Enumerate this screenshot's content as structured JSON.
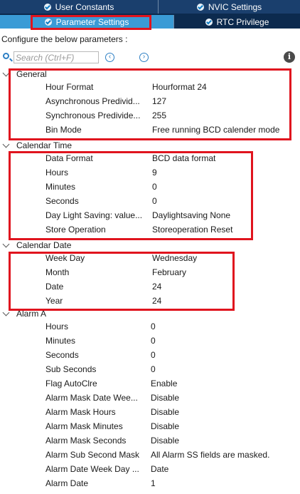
{
  "tabs": {
    "user_constants": "User Constants",
    "nvic_settings": "NVIC Settings",
    "parameter_settings": "Parameter Settings",
    "rtc_privilege": "RTC Privilege"
  },
  "description": "Configure the below parameters :",
  "search": {
    "placeholder": "Search (Ctrl+F)"
  },
  "nav": {
    "prev": "‹",
    "next": "›"
  },
  "info": "i",
  "groups": {
    "general": {
      "title": "General",
      "rows": [
        {
          "key": "Hour Format",
          "value": "Hourformat 24"
        },
        {
          "key": "Asynchronous Predivid...",
          "value": "127"
        },
        {
          "key": "Synchronous Predivide...",
          "value": "255"
        },
        {
          "key": "Bin Mode",
          "value": "Free running BCD calender mode"
        }
      ]
    },
    "calendar_time": {
      "title": "Calendar Time",
      "rows": [
        {
          "key": "Data Format",
          "value": "BCD data format"
        },
        {
          "key": "Hours",
          "value": "9"
        },
        {
          "key": "Minutes",
          "value": "0"
        },
        {
          "key": "Seconds",
          "value": "0"
        },
        {
          "key": "Day Light Saving: value...",
          "value": "Daylightsaving None"
        },
        {
          "key": "Store Operation",
          "value": "Storeoperation Reset"
        }
      ]
    },
    "calendar_date": {
      "title": "Calendar Date",
      "rows": [
        {
          "key": "Week Day",
          "value": "Wednesday"
        },
        {
          "key": "Month",
          "value": "February"
        },
        {
          "key": "Date",
          "value": "24"
        },
        {
          "key": "Year",
          "value": "24"
        }
      ]
    },
    "alarm_a": {
      "title": "Alarm A",
      "rows": [
        {
          "key": "Hours",
          "value": "0"
        },
        {
          "key": "Minutes",
          "value": "0"
        },
        {
          "key": "Seconds",
          "value": "0"
        },
        {
          "key": "Sub Seconds",
          "value": "0"
        },
        {
          "key": "Flag AutoClre",
          "value": "Enable"
        },
        {
          "key": "Alarm Mask Date Wee...",
          "value": "Disable"
        },
        {
          "key": "Alarm Mask Hours",
          "value": "Disable"
        },
        {
          "key": "Alarm Mask Minutes",
          "value": "Disable"
        },
        {
          "key": "Alarm Mask Seconds",
          "value": "Disable"
        },
        {
          "key": "Alarm Sub Second Mask",
          "value": "All Alarm SS fields are masked."
        },
        {
          "key": "Alarm Date Week Day ...",
          "value": "Date"
        },
        {
          "key": "Alarm Date",
          "value": "1"
        }
      ]
    }
  },
  "colors": {
    "tab_bar": "#0c2a4e",
    "active_tab": "#3a9bd6",
    "highlight": "#e0141e",
    "accent": "#2d7fc4"
  }
}
